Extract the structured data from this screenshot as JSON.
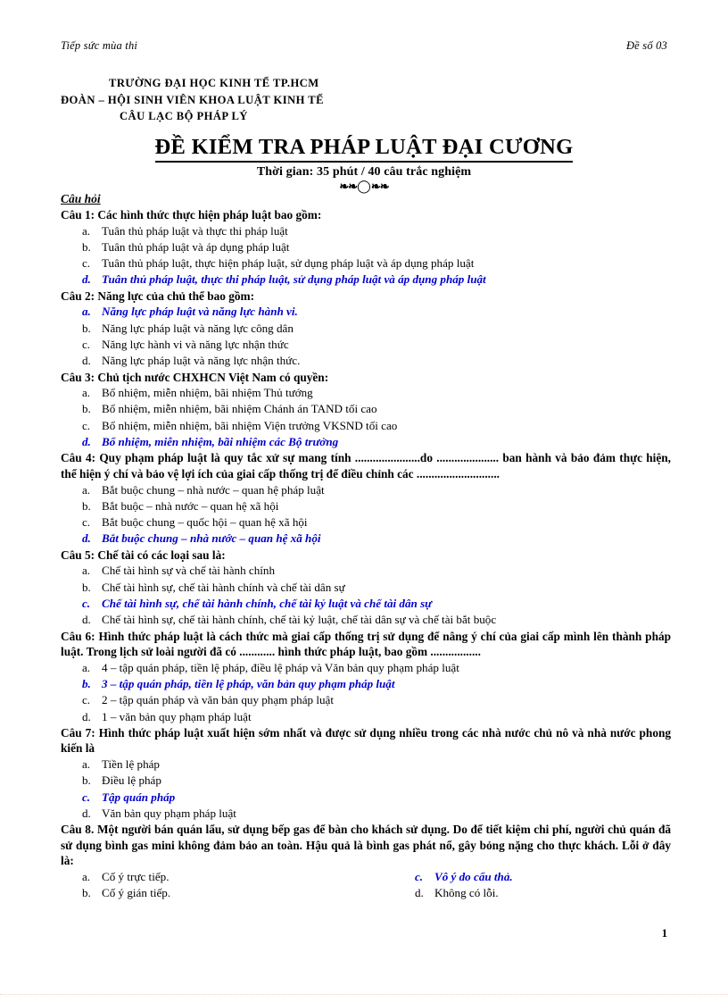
{
  "running_header": {
    "left": "Tiếp sức mùa thi",
    "right": "Đề số 03"
  },
  "institution": {
    "line1": "TRƯỜNG  ĐẠI HỌC  KINH  TẾ TP.HCM",
    "line2": "ĐOÀN – HỘI  SINH  VIÊN  KHOA  LUẬT  KINH  TẾ",
    "line3": "CÂU LẠC BỘ PHÁP LÝ"
  },
  "title": {
    "main": "ĐỀ KIỂM TRA PHÁP LUẬT ĐẠI CƯƠNG",
    "subtitle": "Thời gian: 35 phút / 40 câu trắc nghiệm",
    "ornament_left": "❧❧",
    "ornament_clock": "◯",
    "ornament_right": "❧❧"
  },
  "section_heading": "Câu hỏi",
  "colors": {
    "correct_answer": "#0000CD",
    "text": "#000000",
    "background": "#FFFFFF"
  },
  "questions": [
    {
      "number": "Câu 1:",
      "stem": "Các hình thức thực hiện pháp luật bao gồm:",
      "layout": "one-column",
      "options": [
        {
          "mark": "a.",
          "text": "Tuân thủ pháp luật và thực thi pháp luật",
          "correct": false
        },
        {
          "mark": "b.",
          "text": "Tuân thủ pháp luật và áp dụng pháp luật",
          "correct": false
        },
        {
          "mark": "c.",
          "text": "Tuân thủ pháp luật, thực hiện pháp luật, sử dụng pháp luật và áp dụng pháp luật",
          "correct": false
        },
        {
          "mark": "d.",
          "text": "Tuân thủ pháp luật, thực thi pháp luật, sử dụng pháp luật và áp dụng pháp luật",
          "correct": true
        }
      ]
    },
    {
      "number": "Câu 2:",
      "stem": "Năng lực của chủ thể bao gồm:",
      "layout": "one-column",
      "options": [
        {
          "mark": "a.",
          "text": "Năng lực pháp luật và năng lực hành vi.",
          "correct": true
        },
        {
          "mark": "b.",
          "text": "Năng lực pháp luật và năng lực công dân",
          "correct": false
        },
        {
          "mark": "c.",
          "text": "Năng lực hành vi và năng lực nhận thức",
          "correct": false
        },
        {
          "mark": "d.",
          "text": "Năng lực pháp luật và năng lực nhận thức.",
          "correct": false
        }
      ]
    },
    {
      "number": "Câu 3:",
      "stem": "Chủ tịch nước CHXHCN Việt Nam có quyền:",
      "layout": "one-column",
      "options": [
        {
          "mark": "a.",
          "text": "Bổ nhiệm, miễn nhiệm, bãi nhiệm Thủ tướng",
          "correct": false
        },
        {
          "mark": "b.",
          "text": "Bổ nhiệm, miễn nhiệm, bãi nhiệm Chánh án TAND tối cao",
          "correct": false
        },
        {
          "mark": "c.",
          "text": "Bổ nhiệm, miễn nhiệm, bãi nhiệm Viện trưởng VKSND tối cao",
          "correct": false
        },
        {
          "mark": "d.",
          "text": "Bổ nhiệm, miễn nhiệm, bãi nhiệm các Bộ trưởng",
          "correct": true
        }
      ]
    },
    {
      "number": "Câu 4:",
      "stem": "Quy phạm pháp luật là quy tắc xử sự mang tính ......................do ..................... ban hành và bảo đảm thực hiện, thể hiện ý chí và bảo vệ lợi ích của giai cấp thống trị để điều chỉnh các ............................",
      "layout": "one-column",
      "options": [
        {
          "mark": "a.",
          "text": "Bắt buộc chung – nhà nước – quan hệ pháp luật",
          "correct": false
        },
        {
          "mark": "b.",
          "text": "Bắt buộc – nhà nước – quan hệ xã hội",
          "correct": false
        },
        {
          "mark": "c.",
          "text": "Bắt buộc chung – quốc hội – quan hệ xã hội",
          "correct": false
        },
        {
          "mark": "d.",
          "text": "Bắt buộc chung – nhà nước – quan hệ xã hội",
          "correct": true
        }
      ]
    },
    {
      "number": "Câu 5:",
      "stem": "Chế tài có các loại sau là:",
      "layout": "one-column",
      "options": [
        {
          "mark": "a.",
          "text": "Chế tài hình sự và chế tài hành chính",
          "correct": false
        },
        {
          "mark": "b.",
          "text": "Chế tài hình sự, chế tài hành chính và chế tài dân sự",
          "correct": false
        },
        {
          "mark": "c.",
          "text": "Chế tài hình sự, chế tài hành chính, chế tài kỷ luật và chế tài dân sự",
          "correct": true
        },
        {
          "mark": "d.",
          "text": "Chế tài hình sự, chế tài hành chính, chế tài kỷ luật, chế tài dân sự và chế tài bắt buộc",
          "correct": false
        }
      ]
    },
    {
      "number": "Câu 6:",
      "stem": "Hình thức pháp luật là cách thức mà giai cấp thống trị sử dụng để nâng ý chí của giai cấp mình lên thành pháp luật. Trong lịch sử loài người đã có ............ hình thức pháp luật, bao gồm .................",
      "layout": "one-column",
      "options": [
        {
          "mark": "a.",
          "text": "4 – tập quán pháp, tiền lệ pháp, điều lệ pháp và Văn bản quy phạm pháp luật",
          "correct": false
        },
        {
          "mark": "b.",
          "text": "3 – tập quán pháp, tiền lệ pháp, văn bản quy phạm pháp luật",
          "correct": true
        },
        {
          "mark": "c.",
          "text": "2 – tập quán pháp và văn bản quy phạm pháp luật",
          "correct": false
        },
        {
          "mark": "d.",
          "text": "1 – văn bản quy phạm pháp luật",
          "correct": false
        }
      ]
    },
    {
      "number": "Câu 7:",
      "stem": "Hình thức pháp luật xuất hiện sớm nhất và được sử dụng nhiều trong các nhà nước chủ nô và nhà nước phong kiến là",
      "layout": "one-column",
      "options": [
        {
          "mark": "a.",
          "text": "Tiền lệ pháp",
          "correct": false
        },
        {
          "mark": "b.",
          "text": "Điều lệ pháp",
          "correct": false
        },
        {
          "mark": "c.",
          "text": "Tập quán pháp",
          "correct": true
        },
        {
          "mark": "d.",
          "text": "Văn bản quy phạm pháp luật",
          "correct": false
        }
      ]
    },
    {
      "number": "Câu 8.",
      "stem": "Một người bán quán lẩu, sử dụng bếp gas để bàn cho khách sử dụng. Do để tiết kiệm chi phí, người chủ quán đã sử dụng bình gas mini không đảm bảo an toàn. Hậu quả là bình gas phát nổ, gây bỏng nặng cho thực khách. Lỗi ở đây là:",
      "layout": "two-column",
      "options_left": [
        {
          "mark": "a.",
          "text": "Cố ý trực tiếp.",
          "correct": false
        },
        {
          "mark": "b.",
          "text": "Cố ý gián tiếp.",
          "correct": false
        }
      ],
      "options_right": [
        {
          "mark": "c.",
          "text": "Vô ý do cẩu thả.",
          "correct": true
        },
        {
          "mark": "d.",
          "text": "Không có lỗi.",
          "correct": false
        }
      ]
    }
  ],
  "page_number": "1"
}
